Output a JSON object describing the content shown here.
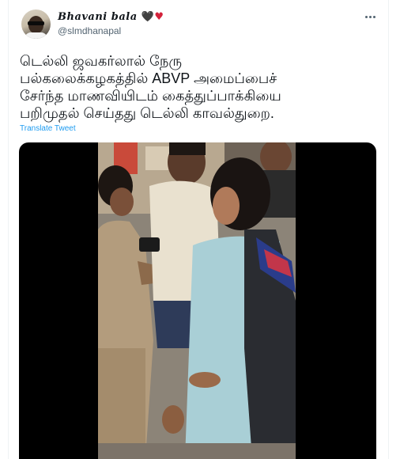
{
  "author": {
    "display_name": "Bhavani bala",
    "handle": "@slmdhanapal",
    "name_emoji_black": "🖤",
    "name_emoji_red": "♥",
    "avatar_icon": "profile-avatar"
  },
  "tweet": {
    "lines": [
      "டெல்லி ஜவகர்லால் நேரு",
      "பல்கலைக்கழகத்தில் ABVP அமைப்பைச்",
      "சேர்ந்த மாணவியிடம் கைத்துப்பாக்கியை",
      "பறிமுதல் செய்தது டெல்லி காவல்துறை."
    ],
    "translate_label": "Translate Tweet",
    "more_icon": "more-options-icon"
  },
  "colors": {
    "link": "#1d9bf0",
    "secondary_text": "#536471",
    "primary_text": "#0f1419"
  }
}
